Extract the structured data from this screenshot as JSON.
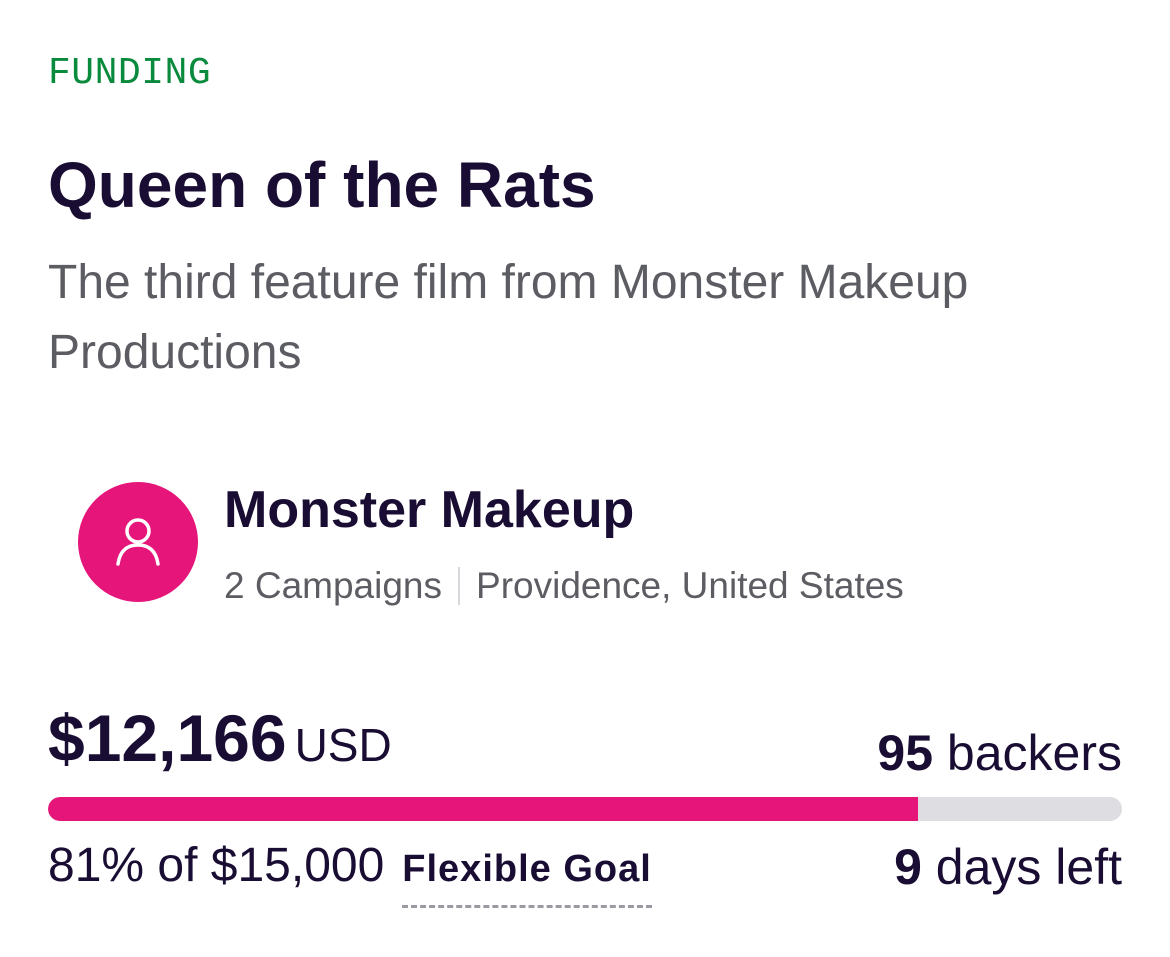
{
  "campaign": {
    "status": "FUNDING",
    "title": "Queen of the Rats",
    "subtitle": "The third feature film from Monster Makeup Productions"
  },
  "creator": {
    "name": "Monster Makeup",
    "campaigns": "2 Campaigns",
    "location": "Providence, United States",
    "avatar_icon": "user-icon"
  },
  "funding": {
    "amount": "$12,166",
    "currency": "USD",
    "backers_count": "95",
    "backers_label": "backers",
    "progress_fraction": 0.81,
    "goal_text": "81% of $15,000",
    "goal_type": "Flexible Goal",
    "days_count": "9",
    "days_label": "days left"
  },
  "colors": {
    "accent": "#e5157a",
    "status": "#0a8a3c",
    "text": "#1a0d33",
    "muted": "#5c5c63",
    "track": "#dedee2"
  }
}
